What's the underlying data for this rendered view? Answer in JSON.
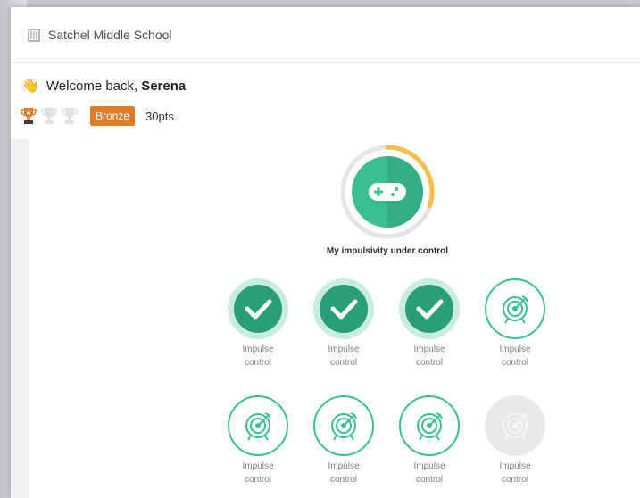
{
  "header": {
    "school_name": "Satchel Middle School",
    "school_icon": "school-building-icon"
  },
  "welcome": {
    "prefix": "Welcome back,",
    "name": "Serena",
    "icon": "waving-hand-icon"
  },
  "rewards": {
    "trophies": [
      {
        "icon": "trophy-icon",
        "state": "earned"
      },
      {
        "icon": "trophy-icon",
        "state": "locked"
      },
      {
        "icon": "trophy-icon",
        "state": "locked"
      }
    ],
    "level": "Bronze",
    "points": "30pts"
  },
  "goal": {
    "icon": "gamepad-icon",
    "title": "My impulsivity under control",
    "progress_fraction": 0.3
  },
  "tasks": [
    {
      "label": "Impulse control",
      "state": "completed"
    },
    {
      "label": "Impulse control",
      "state": "completed"
    },
    {
      "label": "Impulse control",
      "state": "completed"
    },
    {
      "label": "Impulse control",
      "state": "available"
    },
    {
      "label": "Impulse control",
      "state": "available"
    },
    {
      "label": "Impulse control",
      "state": "available"
    },
    {
      "label": "Impulse control",
      "state": "available"
    },
    {
      "label": "Impulse control",
      "state": "locked"
    }
  ],
  "colors": {
    "accent_green": "#3bbf92",
    "dark_green": "#2a9e78",
    "progress_yellow": "#f5be4a",
    "bronze": "#e07c29",
    "locked_gray": "#e7e8ea"
  }
}
